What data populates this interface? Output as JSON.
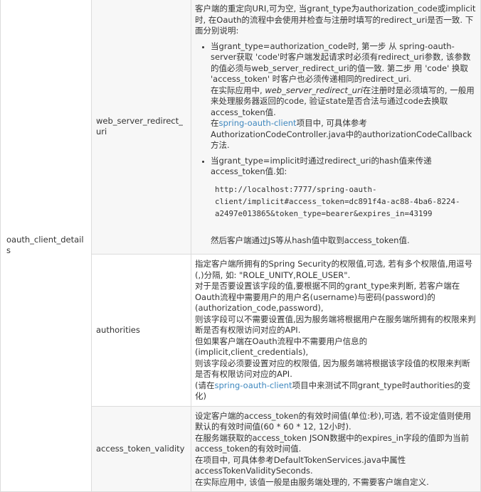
{
  "table_name": "oauth_client_details",
  "rows": [
    {
      "field": "web_server_redirect_uri",
      "intro": "客户端的重定向URI,可为空, 当grant_type为authorization_code或implicit时, 在Oauth的流程中会使用并检查与注册时填写的redirect_uri是否一致. 下面分别说明:",
      "b1": {
        "text1": "当grant_type=authorization_code时, 第一步 从 spring-oauth-server获取 'code'时客户端发起请求时必须有redirect_uri参数, 该参数的值必须与web_server_redirect_uri的值一致. 第二步 用 'code' 换取 'access_token' 时客户也必须传递相同的redirect_uri.",
        "text2_pre": "在实际应用中, ",
        "text2_em": "web_server_redirect_uri",
        "text2_post": "在注册时是必须填写的, 一般用来处理服务器返回的code, 验证state是否合法与通过code去换取access_token值.",
        "text3_pre": "在",
        "text3_link": "spring-oauth-client",
        "text3_post": "项目中, 可具体参考AuthorizationCodeController.java中的authorizationCodeCallback方法."
      },
      "b2": {
        "text": "当grant_type=implicit时通过redirect_uri的hash值来传递access_token值.如:",
        "code": "http://localhost:7777/spring-oauth-client/implicit#access_token=dc891f4a-ac88-4ba6-8224-a2497e013865&token_type=bearer&expires_in=43199",
        "after": "然后客户端通过JS等从hash值中取到access_token值."
      }
    },
    {
      "field": "authorities",
      "l1": "指定客户端所拥有的Spring Security的权限值,可选, 若有多个权限值,用逗号(,)分隔, 如: \"ROLE_UNITY,ROLE_USER\".",
      "l2": "对于是否要设置该字段的值,要根据不同的grant_type来判断, 若客户端在Oauth流程中需要用户的用户名(username)与密码(password)的(authorization_code,password),",
      "l3": "则该字段可以不需要设置值,因为服务端将根据用户在服务端所拥有的权限来判断是否有权限访问对应的API.",
      "l4": "但如果客户端在Oauth流程中不需要用户信息的(implicit,client_credentials),",
      "l5": "则该字段必须要设置对应的权限值, 因为服务端将根据该字段值的权限来判断是否有权限访问对应的API.",
      "l6_pre": "(请在",
      "l6_link": "spring-oauth-client",
      "l6_post": "项目中来测试不同grant_type时authorities的变化)"
    },
    {
      "field": "access_token_validity",
      "l1": "设定客户端的access_token的有效时间值(单位:秒),可选, 若不设定值则使用默认的有效时间值(60 * 60 * 12, 12小时).",
      "l2": "在服务端获取的access_token JSON数据中的expires_in字段的值即为当前access_token的有效时间值.",
      "l3": "在项目中, 可具体参考DefaultTokenServices.java中属性accessTokenValiditySeconds.",
      "l4": "在实际应用中, 该值一般是由服务端处理的, 不需要客户端自定义."
    }
  ]
}
